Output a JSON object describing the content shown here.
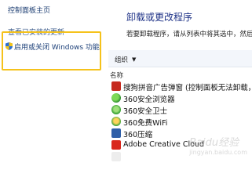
{
  "sidebar": {
    "home_link": "控制面板主页",
    "updates_link": "查看已安装的更新",
    "features_link": "启用或关闭 Windows 功能"
  },
  "main": {
    "heading": "卸载或更改程序",
    "description": "若要卸载程序，请从列表中将其选中，然后",
    "toolbar": {
      "organize_label": "组织"
    },
    "column_name_header": "名称",
    "programs": [
      {
        "name": "搜狗拼音广告弹窗 (控制面板无法卸载，敬",
        "icon": "sogou-icon"
      },
      {
        "name": "360安全浏览器",
        "icon": "360-browser-icon"
      },
      {
        "name": "360安全卫士",
        "icon": "360-guard-icon"
      },
      {
        "name": "360免费WiFi",
        "icon": "360-wifi-icon"
      },
      {
        "name": "360压缩",
        "icon": "360-zip-icon"
      },
      {
        "name": "Adobe Creative Cloud",
        "icon": "adobe-icon"
      }
    ]
  },
  "watermark": {
    "text": "Baidu经验",
    "sub": "jingyan.baidu.com"
  },
  "colors": {
    "highlight": "#f5c21b",
    "heading": "#1e3287",
    "link": "#1e3f73"
  }
}
